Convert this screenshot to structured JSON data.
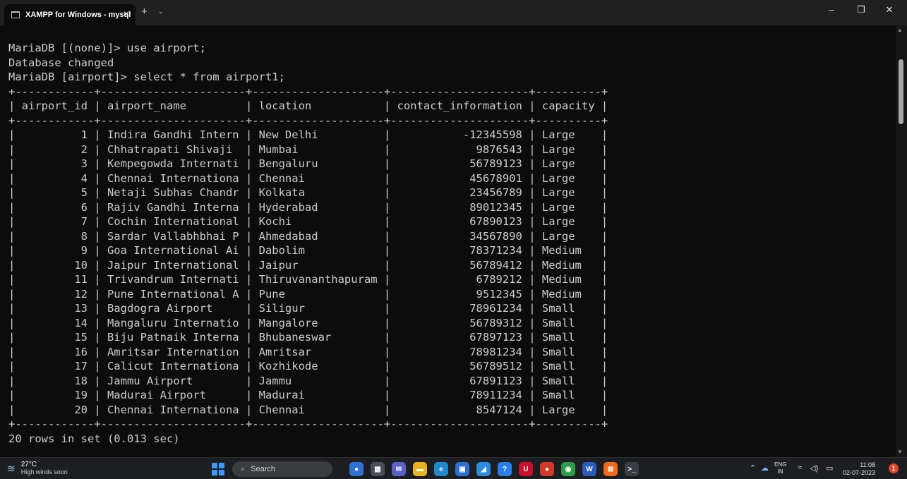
{
  "window": {
    "tab_title": "XAMPP for Windows - mysql",
    "tab_close": "✕",
    "new_tab": "+",
    "dropdown": "⌄",
    "minimize": "–",
    "maximize": "❐",
    "close": "✕"
  },
  "terminal": {
    "lines": [
      "MariaDB [(none)]> use airport;",
      "Database changed",
      "MariaDB [airport]> select * from airport1;",
      "+------------+----------------------+--------------------+---------------------+----------+",
      "| airport_id | airport_name         | location           | contact_information | capacity |",
      "+------------+----------------------+--------------------+---------------------+----------+",
      "|          1 | Indira Gandhi Intern | New Delhi          |           -12345598 | Large    |",
      "|          2 | Chhatrapati Shivaji  | Mumbai             |             9876543 | Large    |",
      "|          3 | Kempegowda Internati | Bengaluru          |            56789123 | Large    |",
      "|          4 | Chennai Internationa | Chennai            |            45678901 | Large    |",
      "|          5 | Netaji Subhas Chandr | Kolkata            |            23456789 | Large    |",
      "|          6 | Rajiv Gandhi Interna | Hyderabad          |            89012345 | Large    |",
      "|          7 | Cochin International | Kochi              |            67890123 | Large    |",
      "|          8 | Sardar Vallabhbhai P | Ahmedabad          |            34567890 | Large    |",
      "|          9 | Goa International Ai | Dabolim            |            78371234 | Medium   |",
      "|         10 | Jaipur International | Jaipur             |            56789412 | Medium   |",
      "|         11 | Trivandrum Internati | Thiruvananthapuram |             6789212 | Medium   |",
      "|         12 | Pune International A | Pune               |             9512345 | Medium   |",
      "|         13 | Bagdogra Airport     | Siligur            |            78961234 | Small    |",
      "|         14 | Mangaluru Internatio | Mangalore          |            56789312 | Small    |",
      "|         15 | Biju Patnaik Interna | Bhubaneswar        |            67897123 | Small    |",
      "|         16 | Amritsar Internation | Amritsar           |            78981234 | Small    |",
      "|         17 | Calicut Internationa | Kozhikode          |            56789512 | Small    |",
      "|         18 | Jammu Airport        | Jammu              |            67891123 | Small    |",
      "|         19 | Madurai Airport      | Madurai            |            78911234 | Small    |",
      "|         20 | Chennai Internationa | Chennai            |             8547124 | Large    |",
      "+------------+----------------------+--------------------+---------------------+----------+",
      "20 rows in set (0.013 sec)"
    ]
  },
  "taskbar": {
    "weather_temp": "27°C",
    "weather_desc": "High winds soon",
    "weather_icon": "wind-icon",
    "search_label": "Search",
    "lang_top": "ENG",
    "lang_bottom": "IN",
    "time": "11:08",
    "date": "02-07-2023",
    "notification": "1",
    "apps": [
      {
        "name": "cortana-icon",
        "glyph": "●",
        "color": "#2f6fd6"
      },
      {
        "name": "task-view-icon",
        "glyph": "▦",
        "color": "#4a4f57"
      },
      {
        "name": "teams-chat-icon",
        "glyph": "✉",
        "color": "#5b5fc7"
      },
      {
        "name": "file-explorer-icon",
        "glyph": "▬",
        "color": "#e8b321"
      },
      {
        "name": "edge-icon",
        "glyph": "e",
        "color": "#1e88c9"
      },
      {
        "name": "microsoft-store-icon",
        "glyph": "▣",
        "color": "#2b6fd1"
      },
      {
        "name": "photos-icon",
        "glyph": "◢",
        "color": "#2a8de0"
      },
      {
        "name": "help-icon",
        "glyph": "?",
        "color": "#2b7de9"
      },
      {
        "name": "mcafee-icon",
        "glyph": "U",
        "color": "#c8102e"
      },
      {
        "name": "office-icon",
        "glyph": "●",
        "color": "#d13b26"
      },
      {
        "name": "chrome-icon",
        "glyph": "◉",
        "color": "#2e9c49"
      },
      {
        "name": "word-icon",
        "glyph": "W",
        "color": "#2b5bbf"
      },
      {
        "name": "xampp-icon",
        "glyph": "⊠",
        "color": "#f26a1b"
      },
      {
        "name": "terminal-icon",
        "glyph": ">_",
        "color": "#3a3d42"
      }
    ]
  }
}
